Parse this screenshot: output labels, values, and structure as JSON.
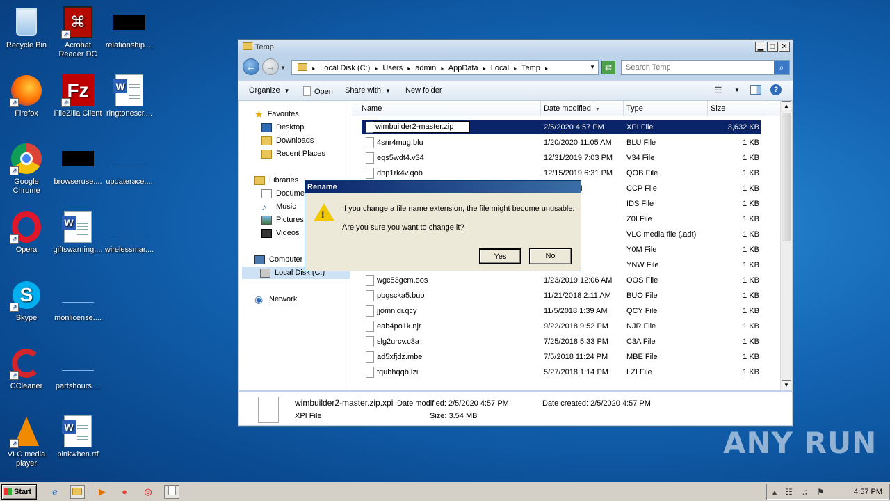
{
  "desktop": {
    "icons": [
      {
        "label": "Recycle Bin",
        "icon": "recycle-bin-icon"
      },
      {
        "label": "Acrobat Reader DC",
        "label1": "Acrobat",
        "label2": "Reader DC",
        "icon": "acrobat-icon"
      },
      {
        "label": "relationship....",
        "icon": "black-file-icon"
      },
      {
        "label": "Firefox",
        "icon": "firefox-icon"
      },
      {
        "label": "FileZilla Client",
        "icon": "filezilla-icon"
      },
      {
        "label": "ringtonescr....",
        "icon": "word-doc-icon"
      },
      {
        "label": "Google Chrome",
        "label1": "Google",
        "label2": "Chrome",
        "icon": "chrome-icon"
      },
      {
        "label": "browseruse....",
        "icon": "black-file-icon"
      },
      {
        "label": "updaterace....",
        "icon": "blank-file-icon"
      },
      {
        "label": "Opera",
        "icon": "opera-icon"
      },
      {
        "label": "giftswarning....",
        "icon": "word-doc-icon"
      },
      {
        "label": "wirelessmar....",
        "icon": "blank-file-icon"
      },
      {
        "label": "Skype",
        "icon": "skype-icon"
      },
      {
        "label": "monlicense....",
        "icon": "blank-file-icon"
      },
      {
        "label": "CCleaner",
        "icon": "ccleaner-icon"
      },
      {
        "label": "partshours....",
        "icon": "blank-file-icon"
      },
      {
        "label": "VLC media player",
        "label1": "VLC media",
        "label2": "player",
        "icon": "vlc-icon"
      },
      {
        "label": "pinkwhen.rtf",
        "icon": "word-doc-icon"
      }
    ]
  },
  "explorer": {
    "title": "Temp",
    "breadcrumbs": [
      "Local Disk (C:)",
      "Users",
      "admin",
      "AppData",
      "Local",
      "Temp"
    ],
    "search_placeholder": "Search Temp",
    "commands": {
      "organize": "Organize",
      "open": "Open",
      "share_with": "Share with",
      "new_folder": "New folder"
    },
    "nav": {
      "favorites": "Favorites",
      "desktop": "Desktop",
      "downloads": "Downloads",
      "recent_places": "Recent Places",
      "libraries": "Libraries",
      "documents": "Documents",
      "music": "Music",
      "pictures": "Pictures",
      "videos": "Videos",
      "computer": "Computer",
      "local_disk": "Local Disk (C:)",
      "network": "Network"
    },
    "columns": {
      "name": "Name",
      "date_modified": "Date modified",
      "type": "Type",
      "size": "Size"
    },
    "files": [
      {
        "name": "wimbuilder2-master.zip",
        "date": "2/5/2020 4:57 PM",
        "type": "XPI File",
        "size": "3,632 KB",
        "selected": true
      },
      {
        "name": "4snr4mug.blu",
        "date": "1/20/2020 11:05 AM",
        "type": "BLU File",
        "size": "1 KB"
      },
      {
        "name": "eqs5wdt4.v34",
        "date": "12/31/2019 7:03 PM",
        "type": "V34 File",
        "size": "1 KB"
      },
      {
        "name": "dhp1rk4v.qob",
        "date": "12/15/2019 6:31 PM",
        "type": "QOB File",
        "size": "1 KB"
      },
      {
        "name": "",
        "date": "9 12:55 AM",
        "type": "CCP File",
        "size": "1 KB"
      },
      {
        "name": "",
        "date": "9 8:36 PM",
        "type": "IDS File",
        "size": "1 KB"
      },
      {
        "name": "",
        "date": "9 2:59 AM",
        "type": "Z0I File",
        "size": "1 KB"
      },
      {
        "name": "",
        "date": "4:49 PM",
        "type": "VLC media file (.adt)",
        "size": "1 KB"
      },
      {
        "name": "",
        "date": ":12 AM",
        "type": "Y0M File",
        "size": "1 KB"
      },
      {
        "name": "",
        "date": "4:25 AM",
        "type": "YNW File",
        "size": "1 KB"
      },
      {
        "name": "wgc53gcm.oos",
        "date": "1/23/2019 12:06 AM",
        "type": "OOS File",
        "size": "1 KB"
      },
      {
        "name": "pbgscka5.buo",
        "date": "11/21/2018 2:11 AM",
        "type": "BUO File",
        "size": "1 KB"
      },
      {
        "name": "jjomnidi.qcy",
        "date": "11/5/2018 1:39 AM",
        "type": "QCY File",
        "size": "1 KB"
      },
      {
        "name": "eab4po1k.njr",
        "date": "9/22/2018 9:52 PM",
        "type": "NJR File",
        "size": "1 KB"
      },
      {
        "name": "slg2urcv.c3a",
        "date": "7/25/2018 5:33 PM",
        "type": "C3A File",
        "size": "1 KB"
      },
      {
        "name": "ad5xfjdz.mbe",
        "date": "7/5/2018 11:24 PM",
        "type": "MBE File",
        "size": "1 KB"
      },
      {
        "name": "fqubhqqb.lzi",
        "date": "5/27/2018 1:14 PM",
        "type": "LZI File",
        "size": "1 KB"
      }
    ],
    "details": {
      "name": "wimbuilder2-master.zip.xpi",
      "type": "XPI File",
      "date_modified": "Date modified:  2/5/2020 4:57 PM",
      "size": "Size:  3.54 MB",
      "date_created": "Date created:  2/5/2020 4:57 PM"
    }
  },
  "dialog": {
    "title": "Rename",
    "message1": "If you change a file name extension, the file might become unusable.",
    "message2": "Are you sure you want to change it?",
    "yes": "Yes",
    "no": "No"
  },
  "taskbar": {
    "start": "Start",
    "clock": "4:57 PM"
  },
  "watermark": "ANY RUN"
}
